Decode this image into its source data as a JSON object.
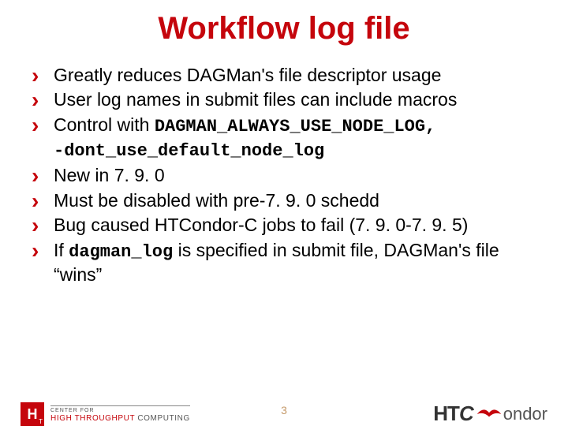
{
  "title": "Workflow log file",
  "bullets": {
    "b0": "Greatly reduces DAGMan's file descriptor usage",
    "b1": "User log names in submit files can include macros",
    "b2_pre": "Control with ",
    "b2_code1": "DAGMAN_ALWAYS_USE_NODE_LOG,",
    "b2_code2": "-dont_use_default_node_log",
    "b3": "New in 7. 9. 0",
    "b4": "Must be disabled with pre-7. 9. 0 schedd",
    "b5": "Bug caused HTCondor-C jobs to fail (7. 9. 0-7. 9. 5)",
    "b6_pre": "If ",
    "b6_code": "dagman_log",
    "b6_post": " is specified in submit file, DAGMan's file “wins”"
  },
  "footer": {
    "left_logo_H": "H",
    "left_logo_T": "T",
    "left_line1": "CENTER FOR",
    "left_line2": "HIGH THROUGHPUT",
    "left_line3": "COMPUTING",
    "slide_number": "3",
    "right_ht": "HT",
    "right_c": "C",
    "right_ondor": "ondor"
  }
}
